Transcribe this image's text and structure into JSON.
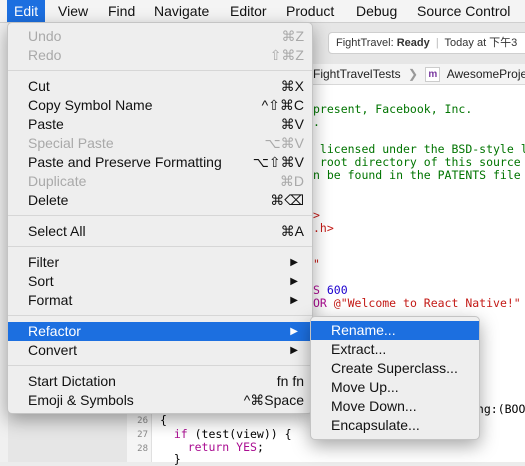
{
  "menubar": {
    "items": [
      {
        "label": "Edit"
      },
      {
        "label": "View"
      },
      {
        "label": "Find"
      },
      {
        "label": "Navigate"
      },
      {
        "label": "Editor"
      },
      {
        "label": "Product"
      },
      {
        "label": "Debug"
      },
      {
        "label": "Source Control"
      }
    ]
  },
  "toolbar": {
    "project": "FightTravel:",
    "status": "Ready",
    "time": "Today at 下午3"
  },
  "jumpbar": {
    "group": "FightTravelTests",
    "file_icon": "m",
    "file": "AwesomeProjectT"
  },
  "code": {
    "l1": "present, Facebook, Inc.",
    "l2": ".",
    "l3": " licensed under the BSD-style li",
    "l4": " root directory of this source t",
    "l5": "n be found in the PATENTS file i",
    "l6": ">",
    "l7": ".h>",
    "l8": "\"",
    "l9a": "S ",
    "l9b": "600",
    "l10a": "OR ",
    "l10b": "@\"Welcome to React Native!\"",
    "l11": "ing:(BOO",
    "ln26": "26",
    "ln27": "27",
    "ln28": "28",
    "c26": "{",
    "c27a": "  if ",
    "c27b": "(test(view)) {",
    "c28a": "    return ",
    "c28b": "YES",
    "c28c": ";",
    "c29": "  }"
  },
  "edit_menu": {
    "items": [
      {
        "label": "Undo",
        "shortcut": "⌘Z"
      },
      {
        "label": "Redo",
        "shortcut": "⇧⌘Z"
      },
      {
        "label": "Cut",
        "shortcut": "⌘X"
      },
      {
        "label": "Copy Symbol Name",
        "shortcut": "^⇧⌘C"
      },
      {
        "label": "Paste",
        "shortcut": "⌘V"
      },
      {
        "label": "Special Paste",
        "shortcut": "⌥⌘V"
      },
      {
        "label": "Paste and Preserve Formatting",
        "shortcut": "⌥⇧⌘V"
      },
      {
        "label": "Duplicate",
        "shortcut": "⌘D"
      },
      {
        "label": "Delete",
        "shortcut": "⌘⌫"
      },
      {
        "label": "Select All",
        "shortcut": "⌘A"
      },
      {
        "label": "Filter",
        "shortcut": "▶"
      },
      {
        "label": "Sort",
        "shortcut": "▶"
      },
      {
        "label": "Format",
        "shortcut": "▶"
      },
      {
        "label": "Refactor",
        "shortcut": "▶"
      },
      {
        "label": "Convert",
        "shortcut": "▶"
      },
      {
        "label": "Start Dictation",
        "shortcut": "fn fn"
      },
      {
        "label": "Emoji & Symbols",
        "shortcut": "^⌘Space"
      }
    ]
  },
  "refactor_menu": {
    "items": [
      {
        "label": "Rename..."
      },
      {
        "label": "Extract..."
      },
      {
        "label": "Create Superclass..."
      },
      {
        "label": "Move Up..."
      },
      {
        "label": "Move Down..."
      },
      {
        "label": "Encapsulate..."
      }
    ]
  },
  "colors": {
    "highlight": "#1c6fe0",
    "disabled": "#a9a9a9"
  }
}
